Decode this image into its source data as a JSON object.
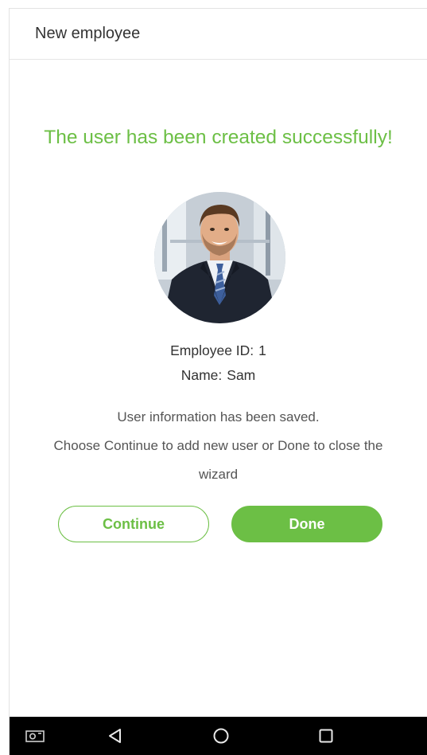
{
  "header": {
    "title": "New employee"
  },
  "success": {
    "message": "The user has been created successfully!",
    "color": "#6cbf45"
  },
  "employee": {
    "id_label": "Employee ID:",
    "id_value": "1",
    "name_label": "Name:",
    "name_value": "Sam"
  },
  "info": {
    "line1": "User information has been saved.",
    "line2": "Choose Continue to add new user or Done to close the",
    "line3": "wizard"
  },
  "buttons": {
    "continue_label": "Continue",
    "done_label": "Done"
  },
  "navbar": {
    "items": [
      "screenshot-icon",
      "back-icon",
      "home-icon",
      "recents-icon"
    ]
  }
}
